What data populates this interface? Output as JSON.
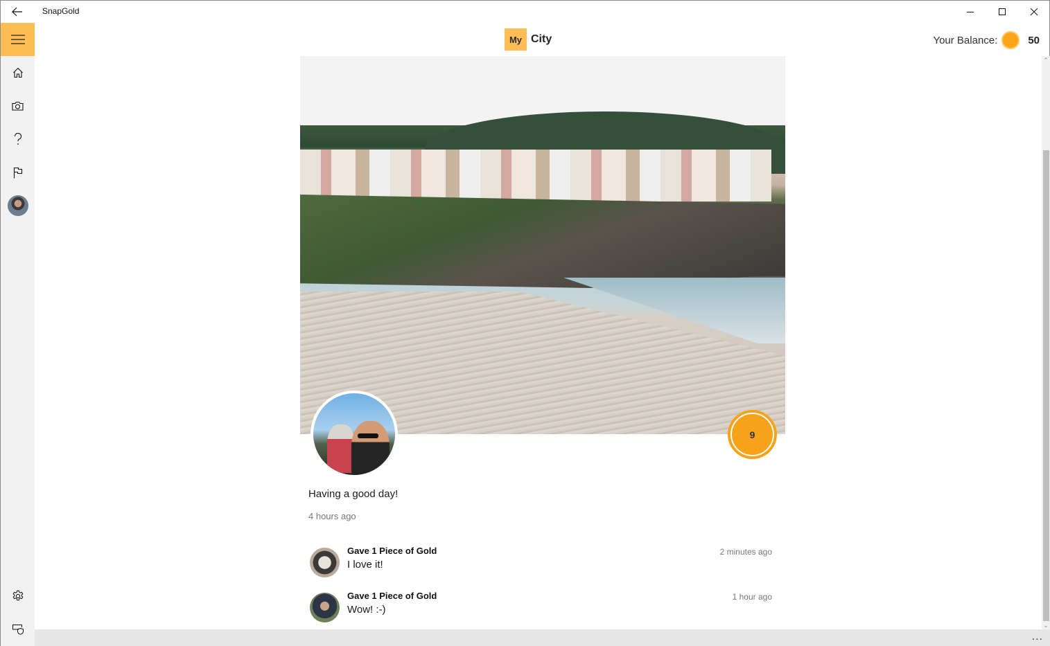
{
  "window": {
    "app_title": "SnapGold",
    "controls": {
      "minimize": "minimize-icon",
      "maximize": "maximize-icon",
      "close": "close-icon"
    }
  },
  "sidebar": {
    "menu_icon": "hamburger-icon",
    "items": [
      {
        "name": "home",
        "icon": "home-icon"
      },
      {
        "name": "camera",
        "icon": "camera-icon"
      },
      {
        "name": "help",
        "icon": "help-icon"
      },
      {
        "name": "report",
        "icon": "flag-icon"
      },
      {
        "name": "profile",
        "icon": "avatar"
      }
    ],
    "bottom_items": [
      {
        "name": "settings",
        "icon": "gear-icon"
      },
      {
        "name": "privacy",
        "icon": "device-shield-icon"
      }
    ],
    "accent_color": "#ffbd55"
  },
  "header": {
    "title_prefix": "My",
    "title": "City",
    "balance_label": "Your Balance:",
    "balance_value": "50",
    "coin_color": "#ffa31a"
  },
  "post": {
    "gold_count": "9",
    "caption": "Having a good day!",
    "posted": "4 hours ago",
    "comments": [
      {
        "title": "Gave 1 Piece of Gold",
        "text": "I love it!",
        "time": "2 minutes ago"
      },
      {
        "title": "Gave 1 Piece of Gold",
        "text": "Wow! :-)",
        "time": "1 hour ago"
      }
    ]
  },
  "appbar": {
    "more_label": "..."
  }
}
